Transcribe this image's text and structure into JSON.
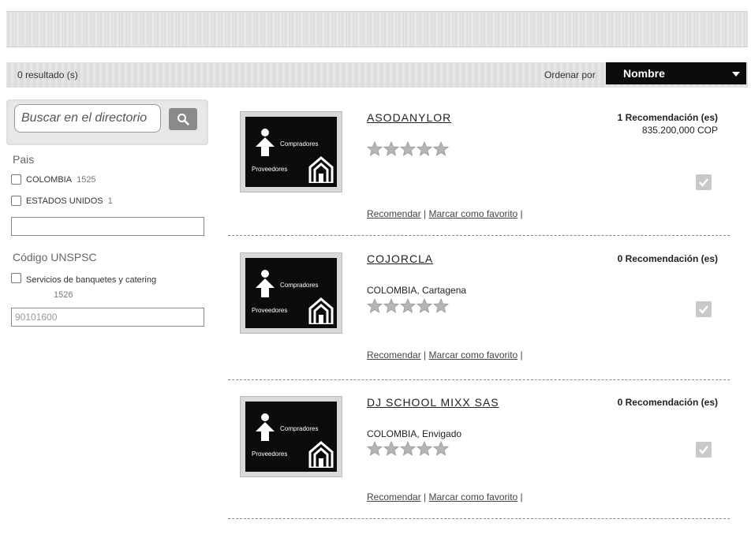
{
  "results": {
    "count_text": "0 resultado (s)",
    "sort_label": "Ordenar por",
    "sort_value": "Nombre"
  },
  "sidebar": {
    "search_placeholder": "Buscar en el directorio",
    "country_heading": "Pais",
    "countries": [
      {
        "label": "COLOMBIA",
        "count": "1525"
      },
      {
        "label": "ESTADOS UNIDOS",
        "count": "1"
      }
    ],
    "country_field_value": "",
    "unspsc_heading": "Código UNSPSC",
    "unspsc_option": {
      "label": "Servicios de banquetes y catering",
      "count": "1526"
    },
    "unspsc_field_value": "90101600"
  },
  "logo_text": {
    "top": "Compradores",
    "bottom": "Proveedores"
  },
  "listings": [
    {
      "name": "ASODANYLOR",
      "location": "",
      "recommendations": "1 Recomendación (es)",
      "amount": "835.200,000 COP",
      "recommend_link": "Recomendar",
      "favorite_link": "Marcar como favorito"
    },
    {
      "name": "COJORCLA",
      "location": "COLOMBIA, Cartagena",
      "recommendations": "0 Recomendación (es)",
      "amount": "",
      "recommend_link": "Recomendar",
      "favorite_link": "Marcar como favorito"
    },
    {
      "name": "DJ SCHOOL MIXX SAS",
      "location": "COLOMBIA, Envigado",
      "recommendations": "0 Recomendación (es)",
      "amount": "",
      "recommend_link": "Recomendar",
      "favorite_link": "Marcar como favorito"
    }
  ],
  "rating_stars": 5,
  "colors": {
    "sort_bg": "#0c0c0c",
    "logo_bg": "#0b0b0b",
    "star": "#b5b5b5"
  }
}
